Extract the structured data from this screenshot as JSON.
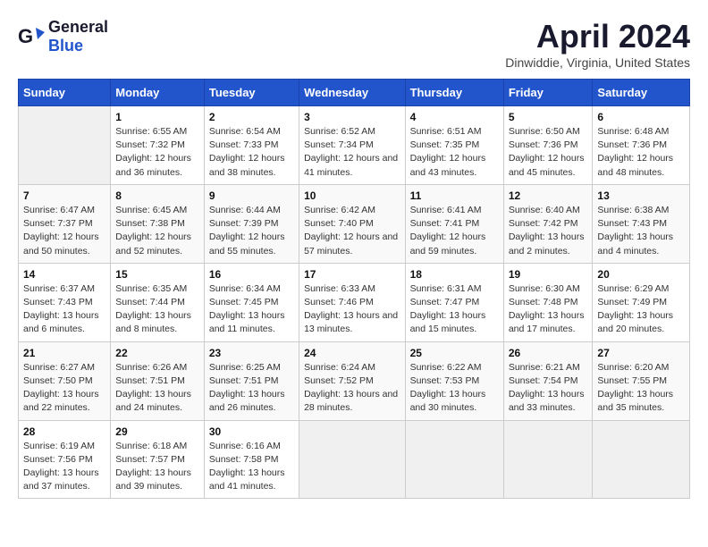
{
  "logo": {
    "general": "General",
    "blue": "Blue"
  },
  "title": "April 2024",
  "subtitle": "Dinwiddie, Virginia, United States",
  "days_header": [
    "Sunday",
    "Monday",
    "Tuesday",
    "Wednesday",
    "Thursday",
    "Friday",
    "Saturday"
  ],
  "weeks": [
    [
      {
        "num": "",
        "sunrise": "",
        "sunset": "",
        "daylight": "",
        "empty": true
      },
      {
        "num": "1",
        "sunrise": "Sunrise: 6:55 AM",
        "sunset": "Sunset: 7:32 PM",
        "daylight": "Daylight: 12 hours and 36 minutes."
      },
      {
        "num": "2",
        "sunrise": "Sunrise: 6:54 AM",
        "sunset": "Sunset: 7:33 PM",
        "daylight": "Daylight: 12 hours and 38 minutes."
      },
      {
        "num": "3",
        "sunrise": "Sunrise: 6:52 AM",
        "sunset": "Sunset: 7:34 PM",
        "daylight": "Daylight: 12 hours and 41 minutes."
      },
      {
        "num": "4",
        "sunrise": "Sunrise: 6:51 AM",
        "sunset": "Sunset: 7:35 PM",
        "daylight": "Daylight: 12 hours and 43 minutes."
      },
      {
        "num": "5",
        "sunrise": "Sunrise: 6:50 AM",
        "sunset": "Sunset: 7:36 PM",
        "daylight": "Daylight: 12 hours and 45 minutes."
      },
      {
        "num": "6",
        "sunrise": "Sunrise: 6:48 AM",
        "sunset": "Sunset: 7:36 PM",
        "daylight": "Daylight: 12 hours and 48 minutes."
      }
    ],
    [
      {
        "num": "7",
        "sunrise": "Sunrise: 6:47 AM",
        "sunset": "Sunset: 7:37 PM",
        "daylight": "Daylight: 12 hours and 50 minutes."
      },
      {
        "num": "8",
        "sunrise": "Sunrise: 6:45 AM",
        "sunset": "Sunset: 7:38 PM",
        "daylight": "Daylight: 12 hours and 52 minutes."
      },
      {
        "num": "9",
        "sunrise": "Sunrise: 6:44 AM",
        "sunset": "Sunset: 7:39 PM",
        "daylight": "Daylight: 12 hours and 55 minutes."
      },
      {
        "num": "10",
        "sunrise": "Sunrise: 6:42 AM",
        "sunset": "Sunset: 7:40 PM",
        "daylight": "Daylight: 12 hours and 57 minutes."
      },
      {
        "num": "11",
        "sunrise": "Sunrise: 6:41 AM",
        "sunset": "Sunset: 7:41 PM",
        "daylight": "Daylight: 12 hours and 59 minutes."
      },
      {
        "num": "12",
        "sunrise": "Sunrise: 6:40 AM",
        "sunset": "Sunset: 7:42 PM",
        "daylight": "Daylight: 13 hours and 2 minutes."
      },
      {
        "num": "13",
        "sunrise": "Sunrise: 6:38 AM",
        "sunset": "Sunset: 7:43 PM",
        "daylight": "Daylight: 13 hours and 4 minutes."
      }
    ],
    [
      {
        "num": "14",
        "sunrise": "Sunrise: 6:37 AM",
        "sunset": "Sunset: 7:43 PM",
        "daylight": "Daylight: 13 hours and 6 minutes."
      },
      {
        "num": "15",
        "sunrise": "Sunrise: 6:35 AM",
        "sunset": "Sunset: 7:44 PM",
        "daylight": "Daylight: 13 hours and 8 minutes."
      },
      {
        "num": "16",
        "sunrise": "Sunrise: 6:34 AM",
        "sunset": "Sunset: 7:45 PM",
        "daylight": "Daylight: 13 hours and 11 minutes."
      },
      {
        "num": "17",
        "sunrise": "Sunrise: 6:33 AM",
        "sunset": "Sunset: 7:46 PM",
        "daylight": "Daylight: 13 hours and 13 minutes."
      },
      {
        "num": "18",
        "sunrise": "Sunrise: 6:31 AM",
        "sunset": "Sunset: 7:47 PM",
        "daylight": "Daylight: 13 hours and 15 minutes."
      },
      {
        "num": "19",
        "sunrise": "Sunrise: 6:30 AM",
        "sunset": "Sunset: 7:48 PM",
        "daylight": "Daylight: 13 hours and 17 minutes."
      },
      {
        "num": "20",
        "sunrise": "Sunrise: 6:29 AM",
        "sunset": "Sunset: 7:49 PM",
        "daylight": "Daylight: 13 hours and 20 minutes."
      }
    ],
    [
      {
        "num": "21",
        "sunrise": "Sunrise: 6:27 AM",
        "sunset": "Sunset: 7:50 PM",
        "daylight": "Daylight: 13 hours and 22 minutes."
      },
      {
        "num": "22",
        "sunrise": "Sunrise: 6:26 AM",
        "sunset": "Sunset: 7:51 PM",
        "daylight": "Daylight: 13 hours and 24 minutes."
      },
      {
        "num": "23",
        "sunrise": "Sunrise: 6:25 AM",
        "sunset": "Sunset: 7:51 PM",
        "daylight": "Daylight: 13 hours and 26 minutes."
      },
      {
        "num": "24",
        "sunrise": "Sunrise: 6:24 AM",
        "sunset": "Sunset: 7:52 PM",
        "daylight": "Daylight: 13 hours and 28 minutes."
      },
      {
        "num": "25",
        "sunrise": "Sunrise: 6:22 AM",
        "sunset": "Sunset: 7:53 PM",
        "daylight": "Daylight: 13 hours and 30 minutes."
      },
      {
        "num": "26",
        "sunrise": "Sunrise: 6:21 AM",
        "sunset": "Sunset: 7:54 PM",
        "daylight": "Daylight: 13 hours and 33 minutes."
      },
      {
        "num": "27",
        "sunrise": "Sunrise: 6:20 AM",
        "sunset": "Sunset: 7:55 PM",
        "daylight": "Daylight: 13 hours and 35 minutes."
      }
    ],
    [
      {
        "num": "28",
        "sunrise": "Sunrise: 6:19 AM",
        "sunset": "Sunset: 7:56 PM",
        "daylight": "Daylight: 13 hours and 37 minutes."
      },
      {
        "num": "29",
        "sunrise": "Sunrise: 6:18 AM",
        "sunset": "Sunset: 7:57 PM",
        "daylight": "Daylight: 13 hours and 39 minutes."
      },
      {
        "num": "30",
        "sunrise": "Sunrise: 6:16 AM",
        "sunset": "Sunset: 7:58 PM",
        "daylight": "Daylight: 13 hours and 41 minutes."
      },
      {
        "num": "",
        "sunrise": "",
        "sunset": "",
        "daylight": "",
        "empty": true
      },
      {
        "num": "",
        "sunrise": "",
        "sunset": "",
        "daylight": "",
        "empty": true
      },
      {
        "num": "",
        "sunrise": "",
        "sunset": "",
        "daylight": "",
        "empty": true
      },
      {
        "num": "",
        "sunrise": "",
        "sunset": "",
        "daylight": "",
        "empty": true
      }
    ]
  ]
}
